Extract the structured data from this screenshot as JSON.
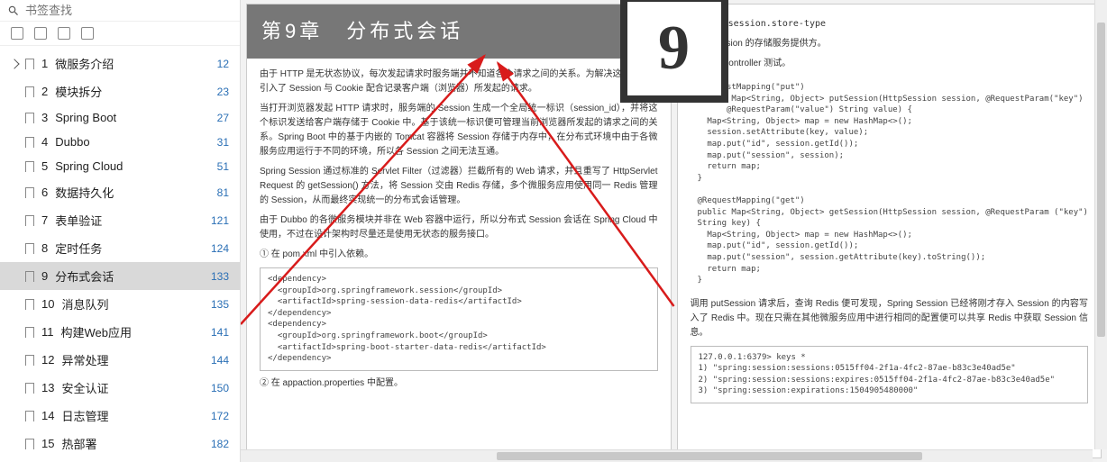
{
  "search": {
    "placeholder": "书签查找"
  },
  "nav": [
    {
      "num": "1",
      "label": "微服务介绍",
      "page": "12",
      "chev": true
    },
    {
      "num": "2",
      "label": "模块拆分",
      "page": "23"
    },
    {
      "num": "3",
      "label": "Spring Boot",
      "page": "27"
    },
    {
      "num": "4",
      "label": "Dubbo",
      "page": "31"
    },
    {
      "num": "5",
      "label": "Spring Cloud",
      "page": "51"
    },
    {
      "num": "6",
      "label": "数据持久化",
      "page": "81"
    },
    {
      "num": "7",
      "label": "表单验证",
      "page": "121"
    },
    {
      "num": "8",
      "label": "定时任务",
      "page": "124"
    },
    {
      "num": "9",
      "label": "分布式会话",
      "page": "133",
      "active": true
    },
    {
      "num": "10",
      "label": "消息队列",
      "page": "135"
    },
    {
      "num": "11",
      "label": "构建Web应用",
      "page": "141"
    },
    {
      "num": "12",
      "label": "异常处理",
      "page": "144"
    },
    {
      "num": "13",
      "label": "安全认证",
      "page": "150"
    },
    {
      "num": "14",
      "label": "日志管理",
      "page": "172"
    },
    {
      "num": "15",
      "label": "热部署",
      "page": "182"
    }
  ],
  "leftPage": {
    "chapterTitle": "第9章　分布式会话",
    "p1": "由于 HTTP 是无状态协议，每次发起请求时服务端并不知道各个请求之间的关系。为解决这个问题，引入了 Session 与 Cookie 配合记录客户端（浏览器）所发起的请求。",
    "p2": "当打开浏览器发起 HTTP 请求时，服务端的 Session 生成一个全局统一标识（session_id），并将这个标识发送给客户端存储于 Cookie 中。基于该统一标识便可管理当前浏览器所发起的请求之间的关系。Spring Boot 中的基于内嵌的 Tomcat 容器将 Session 存储于内存中，在分布式环境中由于各微服务应用运行于不同的环境，所以各 Session 之间无法互通。",
    "p3": "Spring Session 通过标准的 Servlet Filter（过滤器）拦截所有的 Web 请求，并且重写了 HttpServlet Request 的 getSession() 方法，将 Session 交由 Redis 存储，多个微服务应用使用同一 Redis 管理的 Session，从而最终实现统一的分布式会话管理。",
    "p4": "由于 Dubbo 的各微服务模块并非在 Web 容器中运行，所以分布式 Session 会话在 Spring Cloud 中使用，不过在设计架构时尽量还是使用无状态的服务接口。",
    "step1": "① 在 pom.xml 中引入依赖。",
    "code1": "<dependency>\n  <groupId>org.springframework.session</groupId>\n  <artifactId>spring-session-data-redis</artifactId>\n</dependency>\n<dependency>\n  <groupId>org.springframework.boot</groupId>\n  <artifactId>spring-boot-starter-data-redis</artifactId>\n</dependency>",
    "step2": "② 在 appaction.properties 中配置。"
  },
  "rightPage": {
    "prop": "spring.session.store-type",
    "propDesc": "指定 Session 的存储服务提供方。",
    "step3": "③ 编写 Controller 测试。",
    "code2": "@RequestMapping(\"put\")\npublic Map<String, Object> putSession(HttpSession session, @RequestParam(\"key\") String key,\n      @RequestParam(\"value\") String value) {\n  Map<String, Object> map = new HashMap<>();\n  session.setAttribute(key, value);\n  map.put(\"id\", session.getId());\n  map.put(\"session\", session);\n  return map;\n}\n\n@RequestMapping(\"get\")\npublic Map<String, Object> getSession(HttpSession session, @RequestParam (\"key\")\nString key) {\n  Map<String, Object> map = new HashMap<>();\n  map.put(\"id\", session.getId());\n  map.put(\"session\", session.getAttribute(key).toString());\n  return map;\n}",
    "p5": "调用 putSession 请求后，查询 Redis 便可发现，Spring Session 已经将刚才存入 Session 的内容写入了 Redis 中。现在只需在其他微服务应用中进行相同的配置便可以共享 Redis 中获取 Session 信息。",
    "code3": "127.0.0.1:6379> keys *\n1) \"spring:session:sessions:0515ff04-2f1a-4fc2-87ae-b83c3e40ad5e\"\n2) \"spring:session:sessions:expires:0515ff04-2f1a-4fc2-87ae-b83c3e40ad5e\"\n3) \"spring:session:expirations:1504905480000\""
  }
}
